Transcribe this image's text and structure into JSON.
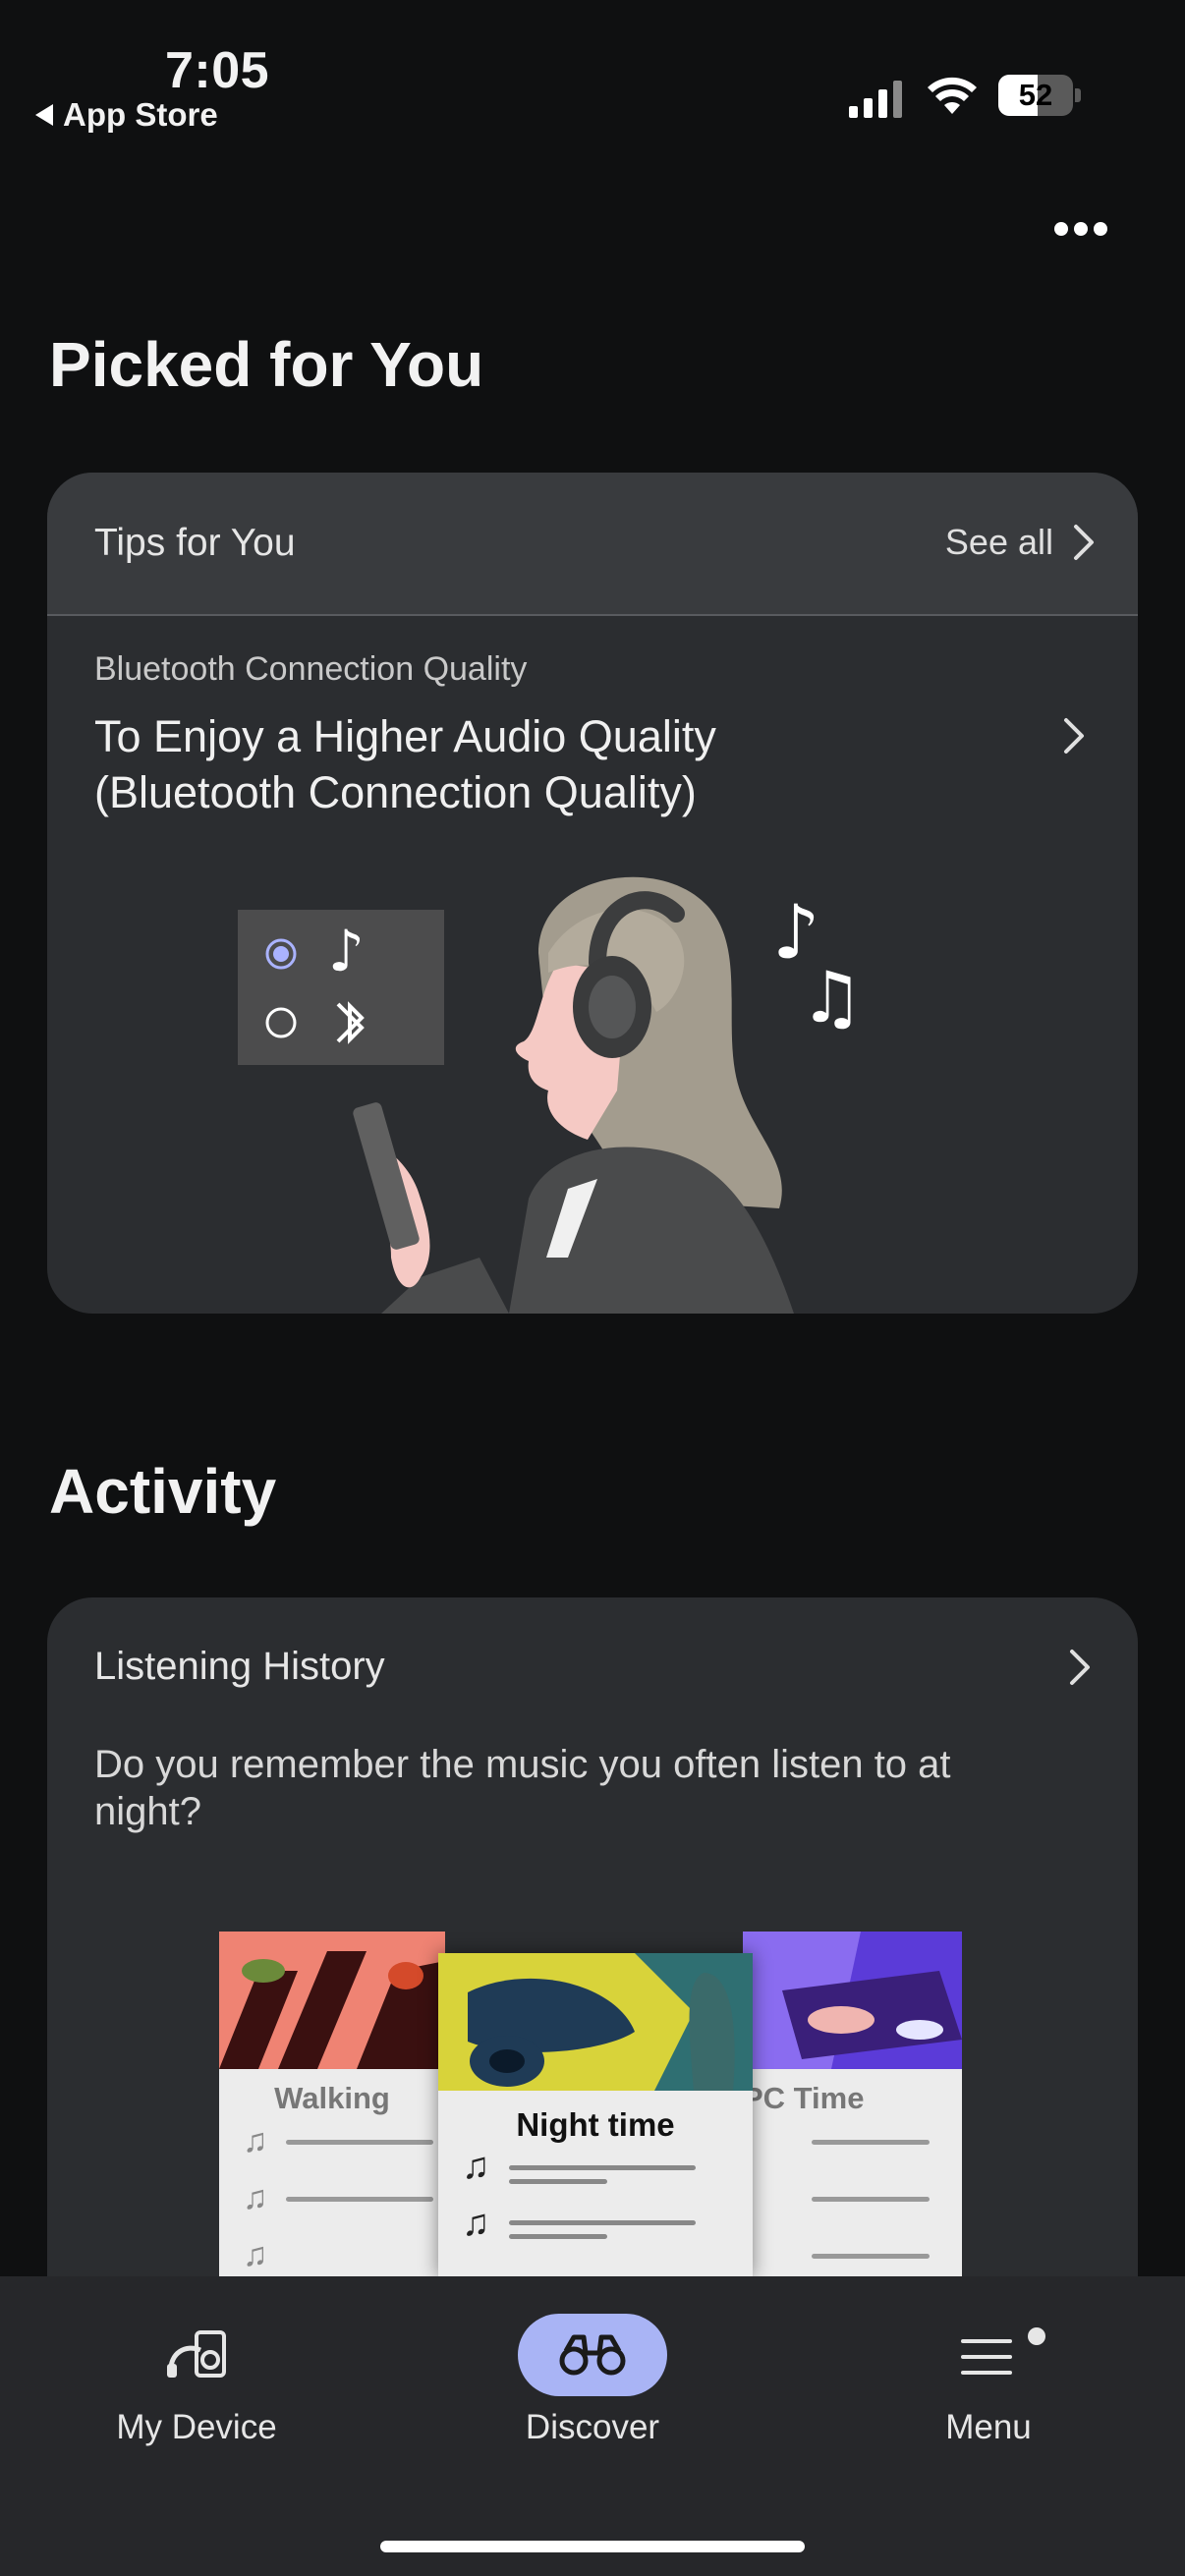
{
  "status_bar": {
    "time": "7:05",
    "back_label": "App Store",
    "battery": "52"
  },
  "header": {
    "more_icon": "ellipsis-icon"
  },
  "picked": {
    "heading": "Picked for You",
    "card": {
      "title": "Tips for You",
      "see_all": "See all",
      "category": "Bluetooth Connection Quality",
      "tip_title_line1": "To Enjoy a Higher Audio Quality",
      "tip_title_line2": "(Bluetooth Connection Quality)",
      "illustration": "woman-with-headphones-illustration"
    }
  },
  "activity": {
    "heading": "Activity",
    "card": {
      "title": "Listening History",
      "text": "Do you remember the music you often listen to at night?",
      "playlists": [
        "Walking",
        "Night time",
        "PC Time"
      ]
    }
  },
  "nav": {
    "items": [
      {
        "label": "My Device",
        "icon": "headphones-speaker-icon"
      },
      {
        "label": "Discover",
        "icon": "binoculars-icon"
      },
      {
        "label": "Menu",
        "icon": "hamburger-menu-icon"
      }
    ],
    "active_color": "#a9b4f5"
  }
}
